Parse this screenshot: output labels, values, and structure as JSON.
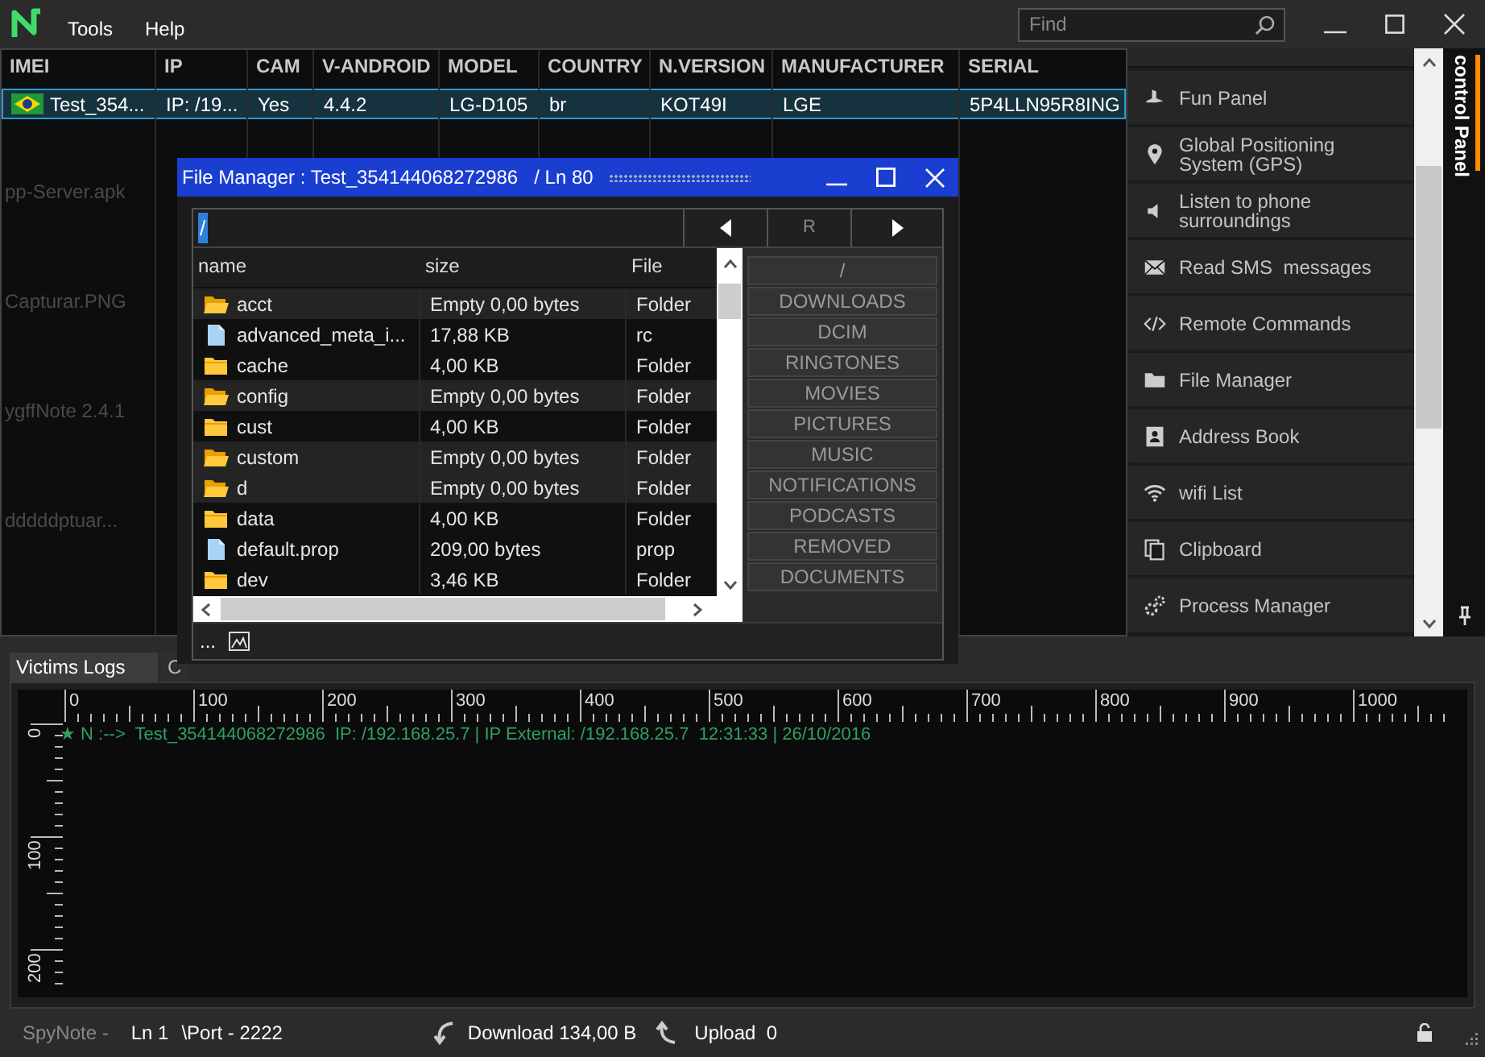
{
  "app": {
    "menu": [
      "Tools",
      "Help"
    ],
    "search": {
      "placeholder": "Find"
    }
  },
  "desktop_labels": [
    "pp-Server.apk",
    "Capturar.PNG",
    "ygffNote 2.4.1",
    "dddddptuar..."
  ],
  "victims": {
    "columns": [
      "IMEI",
      "IP",
      "CAM",
      "V-ANDROID",
      "MODEL",
      "COUNTRY",
      "N.VERSION",
      "MANUFACTURER",
      "SERIAL"
    ],
    "rows": [
      {
        "selected": true,
        "cells": [
          "Test_354...",
          "IP: /19...",
          "Yes",
          "4.4.2",
          "LG-D105",
          "br",
          "KOT49I",
          "LGE",
          "5P4LLN95R8ING"
        ]
      }
    ]
  },
  "control_panel": {
    "items": [
      {
        "label": "Fun Panel"
      },
      {
        "label": "Global Positioning System (GPS)"
      },
      {
        "label": "Listen to phone surroundings"
      },
      {
        "label": "Read SMS  messages"
      },
      {
        "label": "Remote Commands"
      },
      {
        "label": "File Manager"
      },
      {
        "label": "Address Book"
      },
      {
        "label": "wifi List"
      },
      {
        "label": "Clipboard"
      },
      {
        "label": "Process Manager"
      }
    ],
    "side_tab": {
      "label": "control Panel",
      "selected": true
    }
  },
  "file_manager": {
    "title": "File Manager : Test_354144068272986   / Ln 80",
    "path": "/",
    "refresh": "R",
    "columns": [
      "name",
      "size",
      "File"
    ],
    "rows": [
      {
        "kind": "empty_folder",
        "name": "acct",
        "size": "Empty 0,00 bytes",
        "type": "Folder"
      },
      {
        "kind": "file",
        "name": "advanced_meta_i...",
        "size": "17,88 KB",
        "type": "rc"
      },
      {
        "kind": "folder",
        "name": "cache",
        "size": "4,00 KB",
        "type": "Folder"
      },
      {
        "kind": "empty_folder",
        "name": "config",
        "size": "Empty 0,00 bytes",
        "type": "Folder"
      },
      {
        "kind": "folder",
        "name": "cust",
        "size": "4,00 KB",
        "type": "Folder"
      },
      {
        "kind": "empty_folder",
        "name": "custom",
        "size": "Empty 0,00 bytes",
        "type": "Folder"
      },
      {
        "kind": "empty_folder",
        "name": "d",
        "size": "Empty 0,00 bytes",
        "type": "Folder"
      },
      {
        "kind": "folder",
        "name": "data",
        "size": "4,00 KB",
        "type": "Folder"
      },
      {
        "kind": "file",
        "name": "default.prop",
        "size": "209,00 bytes",
        "type": "prop"
      },
      {
        "kind": "folder",
        "name": "dev",
        "size": "3,46 KB",
        "type": "Folder"
      }
    ],
    "shortcuts": [
      "/",
      "DOWNLOADS",
      "DCIM",
      "RINGTONES",
      "MOVIES",
      "PICTURES",
      "MUSIC",
      "NOTIFICATIONS",
      "PODCASTS",
      "REMOVED",
      "DOCUMENTS"
    ],
    "footer": "..."
  },
  "logs": {
    "tabs": [
      {
        "label": "Victims Logs",
        "selected": true
      },
      {
        "label": "C",
        "selected": false
      }
    ],
    "ruler": {
      "x_labels": [
        "0",
        "100",
        "200",
        "300",
        "400",
        "500",
        "600",
        "700",
        "800",
        "900",
        "1000"
      ],
      "y_labels": [
        "0",
        "100",
        "200"
      ]
    },
    "entries": [
      "★ N :-->  Test_354144068272986  IP: /192.168.25.7 | IP External: /192.168.25.7  12:31:33 | 26/10/2016"
    ]
  },
  "status_bar": {
    "app_name": "SpyNote -",
    "line": "Ln 1",
    "port": "\\Port - 2222",
    "download": "Download 134,00 B",
    "upload": "Upload  0"
  }
}
